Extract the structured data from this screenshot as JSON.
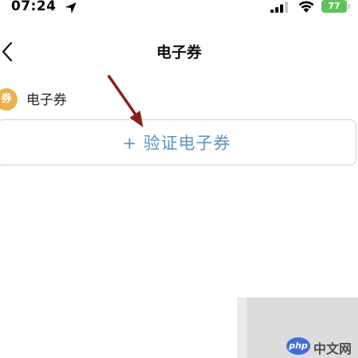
{
  "status_bar": {
    "time": "07:24",
    "battery": "77",
    "icons": [
      "location-arrow-icon",
      "cellular-signal-icon",
      "wifi-icon",
      "battery-icon"
    ],
    "battery_color": "#5ec45a"
  },
  "nav": {
    "back_icon": "chevron-left-icon",
    "title": "电子券"
  },
  "section": {
    "icon": "voucher-ticket-icon",
    "label": "电子券"
  },
  "verify_button": {
    "label": "+ 验证电子券",
    "color": "#5b93be"
  },
  "annotation": {
    "icon": "red-arrow-icon",
    "color": "#8b1d1a"
  },
  "watermark": {
    "logo": "php",
    "text": "中文网"
  }
}
